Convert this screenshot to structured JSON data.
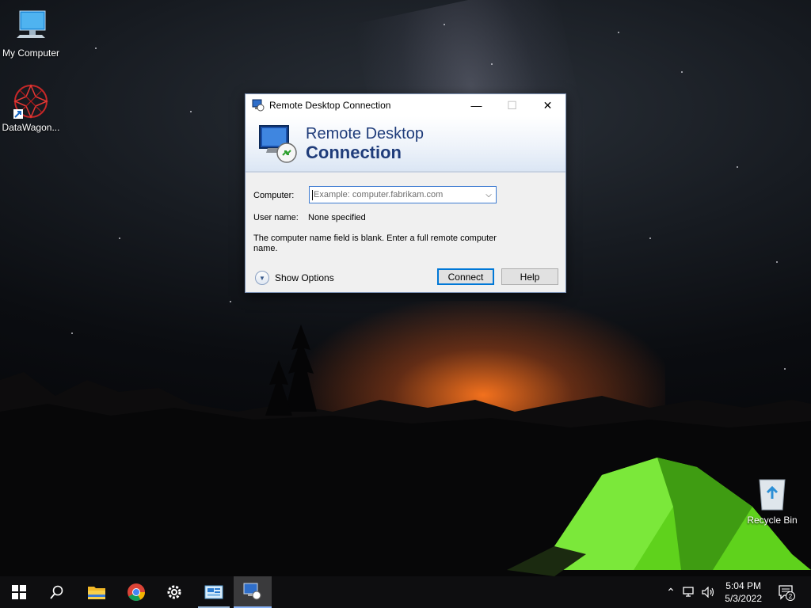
{
  "desktop": {
    "icons": [
      {
        "label": "My Computer",
        "icon": "computer-icon"
      },
      {
        "label": "DataWagon...",
        "icon": "datawagon-shortcut-icon"
      },
      {
        "label": "Recycle Bin",
        "icon": "recycle-bin-icon"
      }
    ]
  },
  "dialog": {
    "title": "Remote Desktop Connection",
    "banner_line1": "Remote Desktop",
    "banner_line2": "Connection",
    "computer_label": "Computer:",
    "computer_placeholder": "Example: computer.fabrikam.com",
    "username_label": "User name:",
    "username_value": "None specified",
    "message": "The computer name field is blank. Enter a full remote computer name.",
    "show_options_label": "Show Options",
    "connect_label": "Connect",
    "help_label": "Help",
    "controls": {
      "minimize": "minimize-icon",
      "maximize": "maximize-icon",
      "close": "close-icon"
    }
  },
  "taskbar": {
    "items": [
      "start-icon",
      "search-icon",
      "file-explorer-icon",
      "chrome-icon",
      "settings-icon",
      "server-manager-icon",
      "remote-desktop-icon"
    ],
    "time": "5:04 PM",
    "date": "5/3/2022",
    "notification_count": "2"
  },
  "colors": {
    "accent": "#0078d7",
    "banner_text": "#1f3c7a",
    "taskbar": "#0e0e10"
  }
}
